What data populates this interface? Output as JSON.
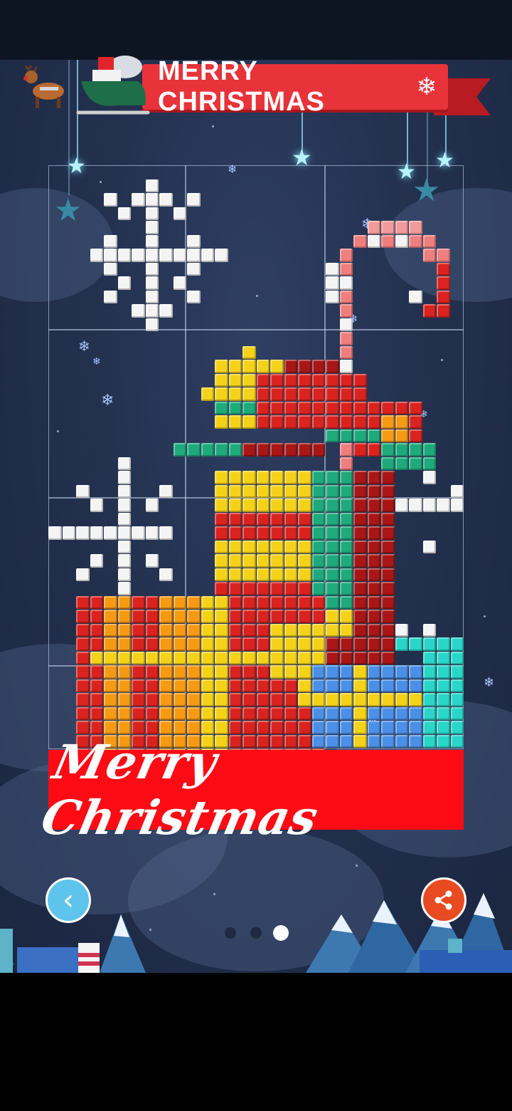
{
  "header": {
    "banner_title": "MERRY CHRISTMAS",
    "banner_icon": "snowflake-icon"
  },
  "artwork": {
    "description_caption": "Merry Christmas",
    "grid": {
      "columns": 3,
      "rows": 4
    }
  },
  "controls": {
    "back_icon": "chevron-left-icon",
    "share_icon": "share-icon",
    "page_indicator": {
      "total": 3,
      "active": 3
    }
  },
  "colors": {
    "banner_red": "#e8333b",
    "caption_red": "#ff0b16",
    "back_blue": "#5fc4ec",
    "share_orange": "#e84a22",
    "bg_navy": "#23314f"
  }
}
